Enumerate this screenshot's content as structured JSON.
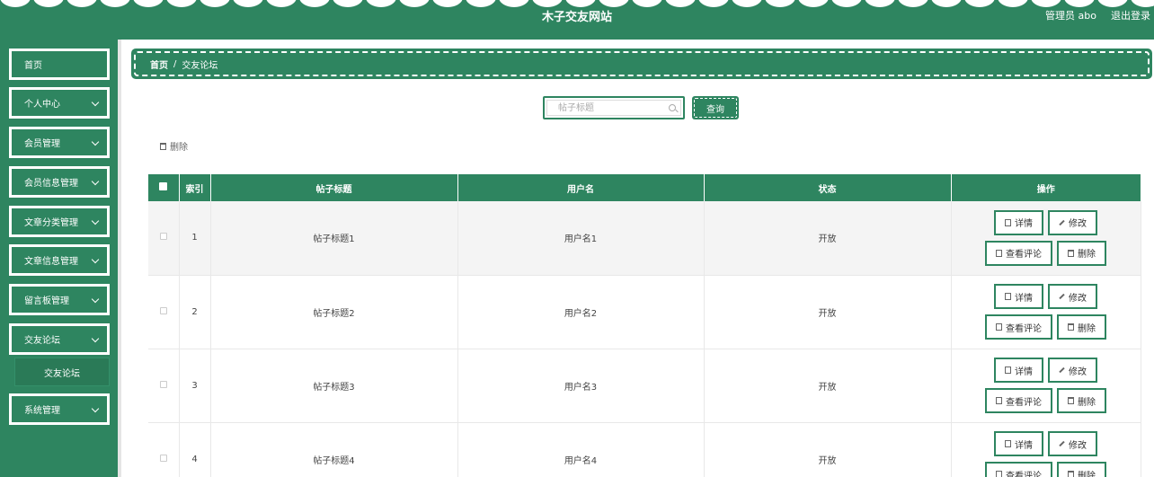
{
  "header": {
    "title": "木子交友网站",
    "user": "管理员 abo",
    "logout": "退出登录"
  },
  "sidebar": {
    "items": [
      {
        "label": "首页",
        "has_chevron": false
      },
      {
        "label": "个人中心",
        "has_chevron": true
      },
      {
        "label": "会员管理",
        "has_chevron": true
      },
      {
        "label": "会员信息管理",
        "has_chevron": true
      },
      {
        "label": "文章分类管理",
        "has_chevron": true
      },
      {
        "label": "文章信息管理",
        "has_chevron": true
      },
      {
        "label": "留言板管理",
        "has_chevron": true
      },
      {
        "label": "交友论坛",
        "has_chevron": true
      },
      {
        "label": "系统管理",
        "has_chevron": true
      }
    ],
    "submenu": "交友论坛"
  },
  "breadcrumb": {
    "home": "首页",
    "separator": "/",
    "current": "交友论坛"
  },
  "search": {
    "placeholder": "帖子标题",
    "button": "查询"
  },
  "toolbar": {
    "delete_label": "删除"
  },
  "table": {
    "headers": [
      "",
      "索引",
      "帖子标题",
      "用户名",
      "状态",
      "操作"
    ],
    "rows": [
      {
        "index": "1",
        "title": "帖子标题1",
        "username": "用户名1",
        "status": "开放"
      },
      {
        "index": "2",
        "title": "帖子标题2",
        "username": "用户名2",
        "status": "开放"
      },
      {
        "index": "3",
        "title": "帖子标题3",
        "username": "用户名3",
        "status": "开放"
      },
      {
        "index": "4",
        "title": "帖子标题4",
        "username": "用户名4",
        "status": "开放"
      }
    ],
    "actions": {
      "detail": "详情",
      "edit": "修改",
      "comments": "查看评论",
      "delete": "删除"
    }
  },
  "colors": {
    "primary": "#2e8560",
    "row_alt": "#f4f4f4"
  }
}
